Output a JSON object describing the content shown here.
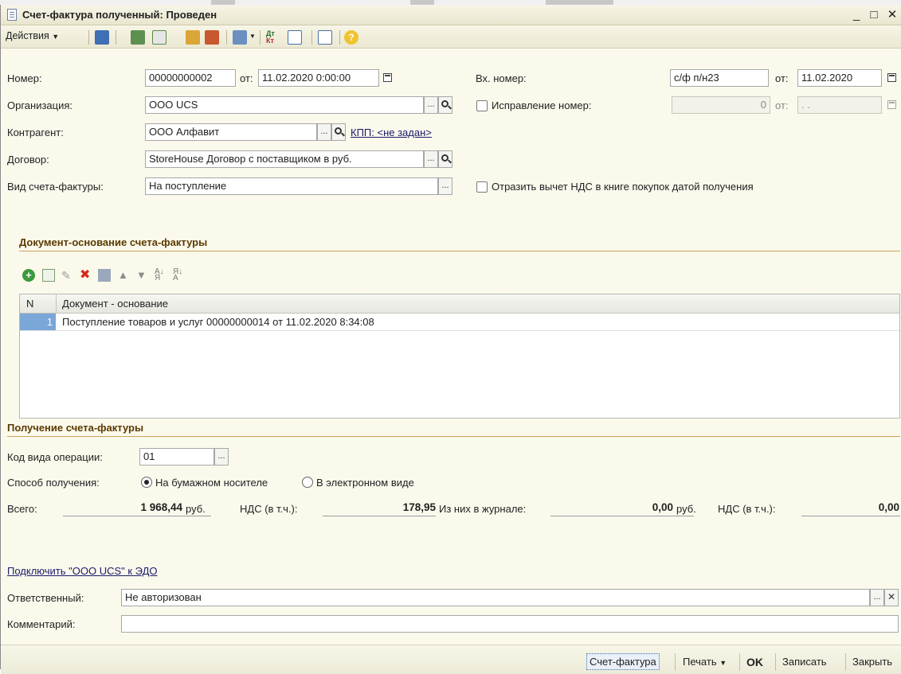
{
  "window": {
    "title": "Счет-фактура полученный: Проведен",
    "minimize": "_",
    "maximize": "□",
    "close": "✕"
  },
  "toolbar": {
    "actions_label": "Действия",
    "icons": [
      "post-doc-icon",
      "refresh-icon",
      "copy-doc-icon",
      "fill-doc-icon",
      "unpost-doc-icon",
      "goto-icon",
      "dt-kt-icon",
      "structure-icon",
      "edit-form-icon",
      "help-icon"
    ]
  },
  "form": {
    "number_label": "Номер:",
    "number_value": "00000000002",
    "from_label": "от:",
    "date_value": "11.02.2020  0:00:00",
    "incoming_number_label": "Вх. номер:",
    "incoming_number_value": "с/ф п/н23",
    "incoming_from_label": "от:",
    "incoming_date_value": "11.02.2020",
    "organization_label": "Организация:",
    "organization_value": "ООО UCS",
    "correction_label": "Исправление номер:",
    "correction_number_value": "0",
    "correction_from_label": "от:",
    "correction_date_value": " .  .",
    "counterparty_label": "Контрагент:",
    "counterparty_value": "ООО Алфавит",
    "kpp_link": "КПП: <не задан>",
    "contract_label": "Договор:",
    "contract_value": "StoreHouse Договор с поставщиком в руб.",
    "invoice_kind_label": "Вид счета-фактуры:",
    "invoice_kind_value": "На поступление",
    "vat_deduction_label": "Отразить вычет НДС в книге покупок датой получения",
    "ellipsis": "..."
  },
  "basis_section": {
    "title": "Документ-основание счета-фактуры",
    "columns": [
      "N",
      "Документ - основание"
    ],
    "rows": [
      {
        "n": "1",
        "document": "Поступление товаров и услуг 00000000014 от 11.02.2020 8:34:08"
      }
    ]
  },
  "receipt_section": {
    "title": "Получение счета-фактуры",
    "op_code_label": "Код вида операции:",
    "op_code_value": "01",
    "method_label": "Способ получения:",
    "method_paper": "На бумажном носителе",
    "method_electronic": "В электронном виде",
    "selected_method": "paper",
    "total_label": "Всего:",
    "total_value": "1 968,44",
    "currency": "руб.",
    "vat_label": "НДС (в т.ч.):",
    "vat_value": "178,95",
    "journal_label": "Из них в журнале:",
    "journal_value": "0,00",
    "journal_currency": "руб.",
    "journal_vat_label": "НДС (в т.ч.):",
    "journal_vat_value": "0,00"
  },
  "edo_link": "Подключить \"ООО UCS\" к ЭДО",
  "responsible_label": "Ответственный:",
  "responsible_value": "Не авторизован",
  "comment_label": "Комментарий:",
  "comment_value": "",
  "footer": {
    "invoice_button": "Счет-фактура",
    "print_button": "Печать",
    "ok_button": "OK",
    "save_button": "Записать",
    "close_button": "Закрыть"
  },
  "colors": {
    "window_bg": "#fbf9ec",
    "section_title": "#5a3a00",
    "selected_row": "#7aa6d8",
    "link": "#1a1a6b"
  }
}
